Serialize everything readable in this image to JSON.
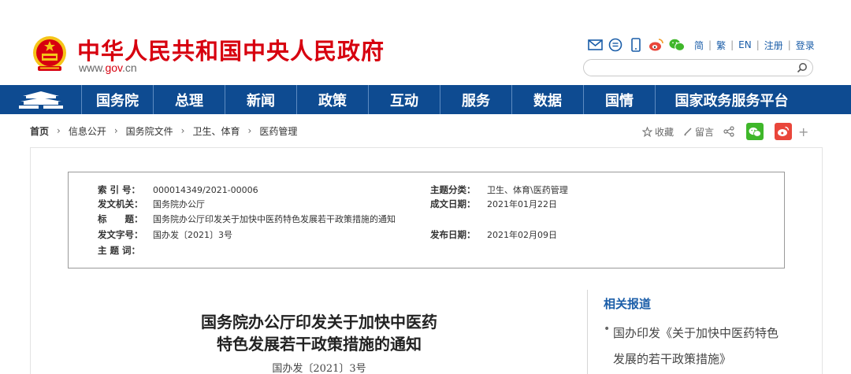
{
  "header": {
    "site_title": "中华人民共和国中央人民政府",
    "url_prefix": "www.",
    "url_domain": "gov",
    "url_suffix": ".cn",
    "links": [
      "简",
      "繁",
      "EN",
      "注册",
      "登录"
    ],
    "tool_icons": [
      "mail-icon",
      "chat-icon",
      "mobile-icon",
      "weibo-icon",
      "wechat-icon"
    ],
    "search_placeholder": ""
  },
  "nav": {
    "items": [
      "国务院",
      "总理",
      "新闻",
      "政策",
      "互动",
      "服务",
      "数据",
      "国情",
      "国家政务服务平台"
    ]
  },
  "breadcrumb": {
    "items": [
      "首页",
      "信息公开",
      "国务院文件",
      "卫生、体育",
      "医药管理"
    ]
  },
  "share": {
    "favorite": "收藏",
    "comment": "留言",
    "plus": "+"
  },
  "info": {
    "index_label": "索 引 号：",
    "index_value": "000014349/2021-00006",
    "category_label": "主题分类：",
    "category_value": "卫生、体育\\医药管理",
    "issuer_label": "发文机关：",
    "issuer_value": "国务院办公厅",
    "created_label": "成文日期：",
    "created_value": "2021年01月22日",
    "title_label": "标　　题：",
    "title_value": "国务院办公厅印发关于加快中医药特色发展若干政策措施的通知",
    "docno_label": "发文字号：",
    "docno_value": "国办发〔2021〕3号",
    "published_label": "发布日期：",
    "published_value": "2021年02月09日",
    "keywords_label": "主 题 词：",
    "keywords_value": ""
  },
  "article": {
    "title_line1": "国务院办公厅印发关于加快中医药",
    "title_line2": "特色发展若干政策措施的通知",
    "doc_number": "国办发〔2021〕3号"
  },
  "related": {
    "heading": "相关报道",
    "bullet": "•",
    "item1": "国办印发《关于加快中医药特色发展的若干政策措施》"
  },
  "colors": {
    "brand_red": "#d7000f",
    "nav_blue": "#0e4b91",
    "link_blue": "#1a5da8"
  }
}
